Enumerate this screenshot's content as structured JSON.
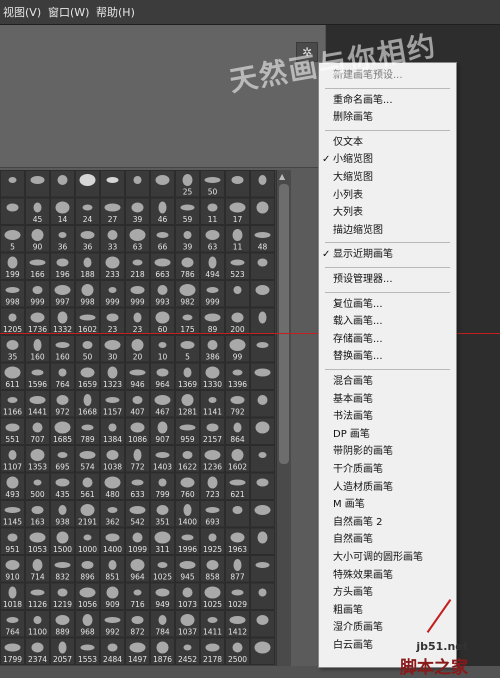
{
  "menubar": {
    "view": "视图(V)",
    "window": "窗口(W)",
    "help": "帮助(H)"
  },
  "panel": {
    "gear_icon": "gear-icon"
  },
  "brush_rows": [
    [
      "",
      "",
      "",
      "",
      "",
      "",
      "",
      "25",
      "50",
      "",
      ""
    ],
    [
      "",
      "45",
      "14",
      "24",
      "27",
      "39",
      "46",
      "59",
      "11",
      "17",
      ""
    ],
    [
      "5",
      "90",
      "36",
      "36",
      "33",
      "63",
      "66",
      "39",
      "63",
      "11",
      "48"
    ],
    [
      "199",
      "166",
      "196",
      "188",
      "233",
      "218",
      "663",
      "786",
      "494",
      "523",
      ""
    ],
    [
      "998",
      "999",
      "997",
      "998",
      "999",
      "999",
      "993",
      "982",
      "999",
      "",
      ""
    ],
    [
      "1205",
      "1736",
      "1332",
      "1602",
      "23",
      "23",
      "60",
      "175",
      "89",
      "200",
      ""
    ],
    [
      "35",
      "160",
      "160",
      "50",
      "30",
      "20",
      "10",
      "5",
      "386",
      "99",
      ""
    ],
    [
      "611",
      "1596",
      "764",
      "1659",
      "1323",
      "946",
      "964",
      "1369",
      "1330",
      "1396",
      ""
    ],
    [
      "1166",
      "1441",
      "972",
      "1668",
      "1157",
      "407",
      "467",
      "1281",
      "1141",
      "792",
      ""
    ],
    [
      "551",
      "707",
      "1685",
      "789",
      "1384",
      "1086",
      "907",
      "959",
      "2157",
      "864",
      ""
    ],
    [
      "1107",
      "1353",
      "695",
      "574",
      "1038",
      "772",
      "1403",
      "1622",
      "1236",
      "1602",
      ""
    ],
    [
      "493",
      "500",
      "435",
      "561",
      "480",
      "633",
      "799",
      "760",
      "723",
      "621",
      ""
    ],
    [
      "1145",
      "163",
      "938",
      "2191",
      "362",
      "542",
      "351",
      "1400",
      "693",
      "",
      ""
    ],
    [
      "951",
      "1053",
      "1500",
      "1000",
      "1400",
      "1099",
      "311",
      "1996",
      "1925",
      "1963",
      ""
    ],
    [
      "910",
      "714",
      "832",
      "896",
      "851",
      "964",
      "1025",
      "945",
      "858",
      "877",
      ""
    ],
    [
      "1018",
      "1126",
      "1219",
      "1056",
      "909",
      "716",
      "949",
      "1073",
      "1025",
      "1029",
      ""
    ],
    [
      "764",
      "1100",
      "889",
      "968",
      "992",
      "872",
      "784",
      "1037",
      "1411",
      "1412",
      ""
    ],
    [
      "1799",
      "2374",
      "2057",
      "1553",
      "2484",
      "1497",
      "1876",
      "2452",
      "2178",
      "2500",
      ""
    ]
  ],
  "menu": {
    "sections": [
      [
        {
          "label": "新建画笔预设..."
        }
      ],
      [
        {
          "label": "重命名画笔..."
        },
        {
          "label": "删除画笔"
        }
      ],
      [
        {
          "label": "仅文本"
        },
        {
          "label": "小缩览图",
          "checked": true
        },
        {
          "label": "大缩览图"
        },
        {
          "label": "小列表"
        },
        {
          "label": "大列表"
        },
        {
          "label": "描边缩览图"
        }
      ],
      [
        {
          "label": "显示近期画笔",
          "checked": true
        }
      ],
      [
        {
          "label": "预设管理器..."
        }
      ],
      [
        {
          "label": "复位画笔..."
        },
        {
          "label": "载入画笔..."
        },
        {
          "label": "存储画笔..."
        },
        {
          "label": "替换画笔..."
        }
      ],
      [
        {
          "label": "混合画笔"
        },
        {
          "label": "基本画笔"
        },
        {
          "label": "书法画笔"
        },
        {
          "label": "DP 画笔"
        },
        {
          "label": "带阴影的画笔"
        },
        {
          "label": "干介质画笔"
        },
        {
          "label": "人造材质画笔"
        },
        {
          "label": "M 画笔"
        },
        {
          "label": "自然画笔 2"
        },
        {
          "label": "自然画笔"
        },
        {
          "label": "大小可调的圆形画笔"
        },
        {
          "label": "特殊效果画笔"
        },
        {
          "label": "方头画笔"
        },
        {
          "label": "粗画笔"
        },
        {
          "label": "湿介质画笔"
        },
        {
          "label": "白云画笔"
        }
      ]
    ]
  },
  "watermark": {
    "text": "天然画与你相约",
    "site": "jb51.net",
    "site_cn": "脚本之家"
  }
}
